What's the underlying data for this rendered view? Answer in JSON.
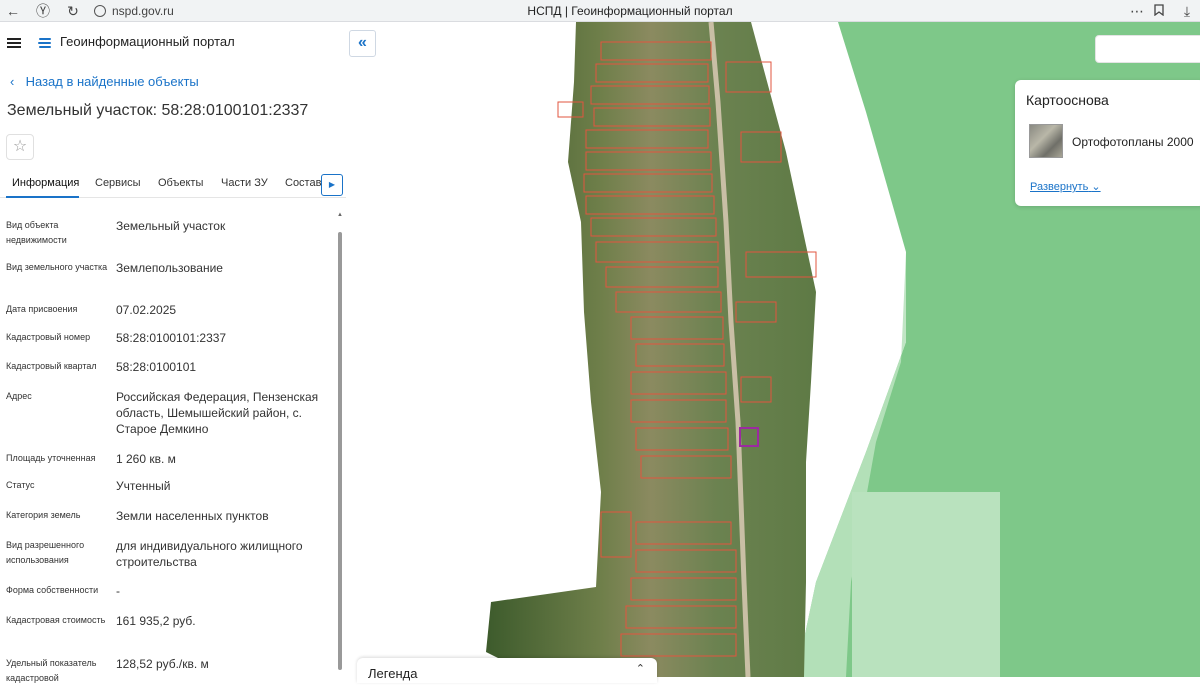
{
  "browser": {
    "url": "nspd.gov.ru",
    "tab_title": "НСПД | Геоинформационный портал",
    "menu_dots": "⋯"
  },
  "header": {
    "portal_title": "Геоинформационный портал"
  },
  "nav": {
    "back_label": "Назад в найденные объекты"
  },
  "object": {
    "title": "Земельный участок: 58:28:0100101:2337"
  },
  "tabs": [
    {
      "label": "Информация",
      "active": true
    },
    {
      "label": "Сервисы"
    },
    {
      "label": "Объекты"
    },
    {
      "label": "Части ЗУ"
    },
    {
      "label": "Состав"
    }
  ],
  "properties": [
    {
      "label": "Вид объекта недвижимости",
      "value": "Земельный участок"
    },
    {
      "label": "Вид земельного участка",
      "value": "Землепользование"
    },
    {
      "label": "Дата присвоения",
      "value": "07.02.2025"
    },
    {
      "label": "Кадастровый номер",
      "value": "58:28:0100101:2337"
    },
    {
      "label": "Кадастровый квартал",
      "value": "58:28:0100101"
    },
    {
      "label": "Адрес",
      "value": "Российская Федерация, Пензенская область, Шемышейский район, с. Старое Демкино"
    },
    {
      "label": "Площадь уточненная",
      "value": "1 260 кв. м"
    },
    {
      "label": "Статус",
      "value": "Учтенный"
    },
    {
      "label": "Категория земель",
      "value": "Земли населенных пунктов"
    },
    {
      "label": "Вид разрешенного использования",
      "value": "для индивидуального жилищного строительства"
    },
    {
      "label": "Форма собственности",
      "value": "-"
    },
    {
      "label": "Кадастровая стоимость",
      "value": "161 935,2 руб."
    },
    {
      "label": "Удельный показатель кадастровой",
      "value": "128,52 руб./кв. м"
    }
  ],
  "basemap": {
    "title": "Картооснова",
    "layer_name": "Ортофотопланы 2000",
    "expand_label": "Развернуть"
  },
  "legend": {
    "title": "Легенда"
  },
  "colors": {
    "accent": "#1a73c8",
    "green_zone": "#7ec889",
    "green_light": "#b9e2be",
    "parcel_outline": "#e2553f",
    "selected_parcel": "#9b2aa0"
  }
}
